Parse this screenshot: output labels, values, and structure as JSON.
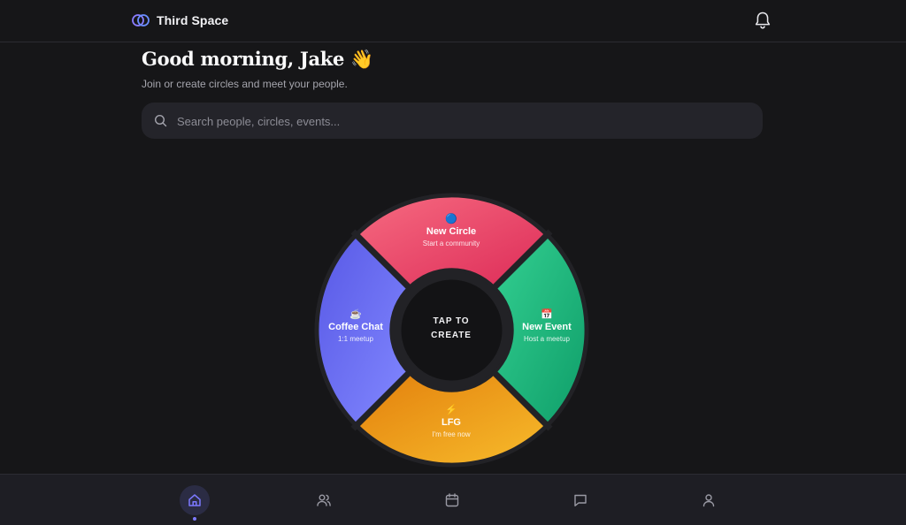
{
  "header": {
    "brand_name": "Third Space",
    "logo_icon": "overlapping-rings-icon",
    "notification_icon": "bell-icon",
    "accent_color": "#7c6cff"
  },
  "greeting": {
    "title": "Good morning, Jake 👋",
    "subtitle": "Join or create circles and meet your people."
  },
  "search": {
    "placeholder": "Search people, circles, events...",
    "value": ""
  },
  "wheel": {
    "center_line1": "TAP TO",
    "center_line2": "CREATE",
    "segments": [
      {
        "id": "new-circle",
        "emoji": "🔵",
        "title": "New Circle",
        "subtitle": "Start a community",
        "color_start": "#f5647a",
        "color_end": "#e0305a"
      },
      {
        "id": "new-event",
        "emoji": "📅",
        "title": "New Event",
        "subtitle": "Host a meetup",
        "color_start": "#2ecb8c",
        "color_end": "#11a56e"
      },
      {
        "id": "lfg",
        "emoji": "⚡",
        "title": "LFG",
        "subtitle": "I'm free now",
        "color_start": "#e8860f",
        "color_end": "#f6b426"
      },
      {
        "id": "coffee-chat",
        "emoji": "☕",
        "title": "Coffee Chat",
        "subtitle": "1:1 meetup",
        "color_start": "#5b5ce8",
        "color_end": "#7f84ff"
      }
    ]
  },
  "bottom_nav": {
    "items": [
      {
        "id": "home",
        "icon": "home-icon",
        "active": true
      },
      {
        "id": "people",
        "icon": "people-icon",
        "active": false
      },
      {
        "id": "calendar",
        "icon": "calendar-icon",
        "active": false
      },
      {
        "id": "messages",
        "icon": "chat-bubble-icon",
        "active": false
      },
      {
        "id": "profile",
        "icon": "user-icon",
        "active": false
      }
    ],
    "active_color": "#7c79ff",
    "inactive_color": "#9a9aa4"
  }
}
